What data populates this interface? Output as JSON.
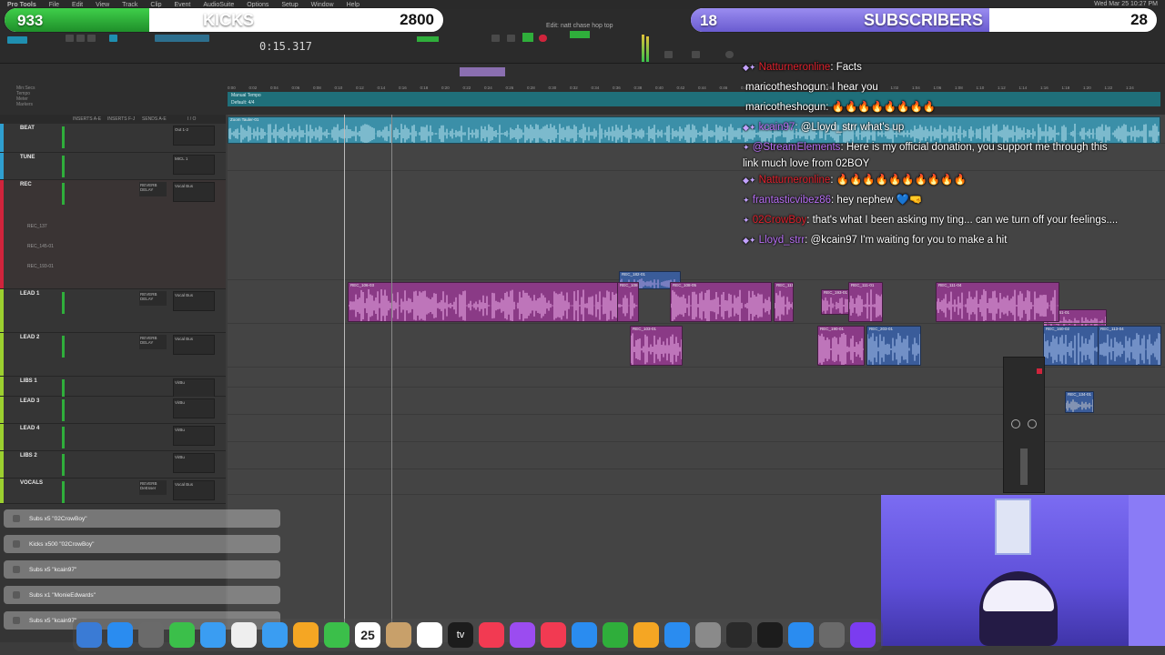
{
  "menubar": {
    "items": [
      "Pro Tools",
      "File",
      "Edit",
      "View",
      "Track",
      "Clip",
      "Event",
      "AudioSuite",
      "Options",
      "Setup",
      "Window",
      "Help"
    ],
    "clock": "Wed Mar 25 10:27 PM"
  },
  "transport": {
    "counter": "0:15.317",
    "edit_window_title": "Edit: natt chase hop top"
  },
  "overlays": {
    "kicks": {
      "left_value": "933",
      "title": "KICKS",
      "right_value": "2800",
      "progress_fraction": 0.33
    },
    "subscribers": {
      "left_value": "18",
      "title": "SUBSCRIBERS",
      "right_value": "28",
      "progress_fraction": 0.64
    }
  },
  "rulers": {
    "labels": [
      "Min:Secs",
      "Tempo",
      "Meter",
      "Markers"
    ],
    "tempo_label": "Manual Tempo",
    "meter_label": "Default: 4/4",
    "ticks": [
      "0:00",
      "0:02",
      "0:04",
      "0:06",
      "0:08",
      "0:10",
      "0:12",
      "0:14",
      "0:16",
      "0:18",
      "0:20",
      "0:22",
      "0:24",
      "0:26",
      "0:28",
      "0:30",
      "0:32",
      "0:34",
      "0:36",
      "0:38",
      "0:40",
      "0:42",
      "0:44",
      "0:46",
      "0:48",
      "0:50",
      "0:52",
      "0:54",
      "0:56",
      "0:58",
      "1:00",
      "1:02",
      "1:04",
      "1:06",
      "1:08",
      "1:10",
      "1:12",
      "1:14",
      "1:16",
      "1:18",
      "1:20",
      "1:22",
      "1:24"
    ]
  },
  "column_headers": [
    "INSERTS A-E",
    "INSERTS F-J",
    "SENDS A-E",
    "I / O"
  ],
  "tracks": [
    {
      "name": "BEAT",
      "color": "#2f9fd0",
      "insert": "Out 1-2",
      "send": ""
    },
    {
      "name": "TUNE",
      "color": "#2f9fd0",
      "insert": "MICL 1",
      "send": ""
    },
    {
      "name": "REC",
      "color": "#d0243c",
      "insert": "Vocal Bus",
      "send": "REVERB",
      "send2": "DELAY",
      "sub": [
        "REC_137",
        "REC_145-01",
        "REC_193-01"
      ]
    },
    {
      "name": "LEAD 1",
      "color": "#9bd02f",
      "insert": "Vocal Bus",
      "send": "REVERB",
      "send2": "DELAY"
    },
    {
      "name": "LEAD 2",
      "color": "#9bd02f",
      "insert": "Vocal Bus",
      "send": "REVERB",
      "send2": "DELAY"
    },
    {
      "name": "LIBS 1",
      "color": "#9bd02f",
      "insert": "VirBu",
      "send": ""
    },
    {
      "name": "LEAD 3",
      "color": "#9bd02f",
      "insert": "VirBu",
      "send": ""
    },
    {
      "name": "LEAD 4",
      "color": "#9bd02f",
      "insert": "VirBu",
      "send": ""
    },
    {
      "name": "LIBS 2",
      "color": "#9bd02f",
      "insert": "VirBu",
      "send": ""
    },
    {
      "name": "VOCALS",
      "color": "#9bd02f",
      "insert": "Vocal Bus",
      "send": "REVERB",
      "send2": "DeEsser"
    }
  ],
  "clips": {
    "beat": "Zoom Tauler-01",
    "rec": [
      "REC_182-01",
      "REC_193-01",
      "REC_161-01"
    ],
    "lead1": [
      "REC_106-03",
      "REC_108-04",
      "REC_108-05",
      "REC_111-03",
      "REC_111-01",
      "REC_111-04"
    ],
    "lead2": [
      "REC_103-01",
      "REC_190-01",
      "REC_203-01",
      "REC_160-02",
      "REC_113-04"
    ],
    "misc": [
      "REC_134-01"
    ]
  },
  "chat": [
    {
      "user": "Natturneronline",
      "user_class": "u-red",
      "badges": "◆✦",
      "text": ": Facts"
    },
    {
      "user": "maricotheshogun",
      "user_class": "u-white",
      "badges": "",
      "text": ": I hear you"
    },
    {
      "user": "maricotheshogun",
      "user_class": "u-white",
      "badges": "",
      "text": ": 🔥🔥🔥🔥🔥🔥🔥🔥"
    },
    {
      "user": "kcain97",
      "user_class": "u-purple",
      "badges": "◆✦",
      "text": ": @Lloyd_strr what's up"
    },
    {
      "user": "@StreamElements",
      "user_class": "u-purple",
      "badges": "✦",
      "text": ": Here is my official donation, you support me through this"
    },
    {
      "user": "",
      "user_class": "u-white",
      "badges": "",
      "text": "link much love from 02BOY"
    },
    {
      "user": "Natturneronline",
      "user_class": "u-red",
      "badges": "◆✦",
      "text": ": 🔥🔥🔥🔥🔥🔥🔥🔥🔥🔥"
    },
    {
      "user": "frantasticvibez86",
      "user_class": "u-purple",
      "badges": "✦",
      "text": ": hey nephew 💙🤜"
    },
    {
      "user": "02CrowBoy",
      "user_class": "u-red",
      "badges": "✦",
      "text": ": that's what I been asking my ting... can we turn off your feelings...."
    },
    {
      "user": "Lloyd_strr",
      "user_class": "u-purple",
      "badges": "◆✦",
      "text": ": @kcain97 I'm waiting for you to make a hit"
    }
  ],
  "alerts": [
    "Subs x5 \"02CrowBoy\"",
    "Kicks x500 \"02CrowBoy\"",
    "Subs x5 \"kcain97\"",
    "Subs x1 \"MonieEdwards\"",
    "Subs x5 \"kcain97\""
  ],
  "dock": {
    "date_day": "25",
    "tv_label": "tv"
  }
}
